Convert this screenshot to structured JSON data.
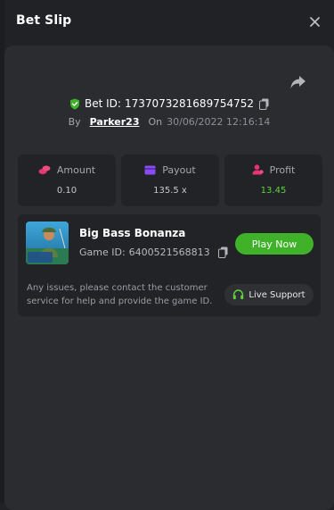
{
  "header": {
    "title": "Bet Slip"
  },
  "bet": {
    "id_label": "Bet ID:",
    "id": "1737073281689754752",
    "by_label": "By",
    "user": "Parker23",
    "on_label": "On",
    "date": "30/06/2022 12:16:14"
  },
  "stats": {
    "amount": {
      "label": "Amount",
      "value": "0.10"
    },
    "payout": {
      "label": "Payout",
      "value": "135.5 x"
    },
    "profit": {
      "label": "Profit",
      "value": "13.45"
    }
  },
  "game": {
    "name": "Big Bass Bonanza",
    "id_label": "Game ID:",
    "id": "6400521568813",
    "play_label": "Play Now",
    "note": "Any issues, please contact the customer service for help and provide the game ID.",
    "support_label": "Live Support"
  },
  "colors": {
    "background": "#202225",
    "panel": "#2a2c30",
    "card": "#212326",
    "accent_green": "#3fb22a",
    "profit_green": "#5ed33d",
    "amount_icon": "#e8356f",
    "payout_icon": "#8a4cf0",
    "profit_icon": "#e8356f"
  },
  "icons": [
    "close-icon",
    "share-icon",
    "shield-check-icon",
    "copy-icon",
    "coins-icon",
    "wallet-icon",
    "user-profit-icon",
    "headset-icon"
  ]
}
